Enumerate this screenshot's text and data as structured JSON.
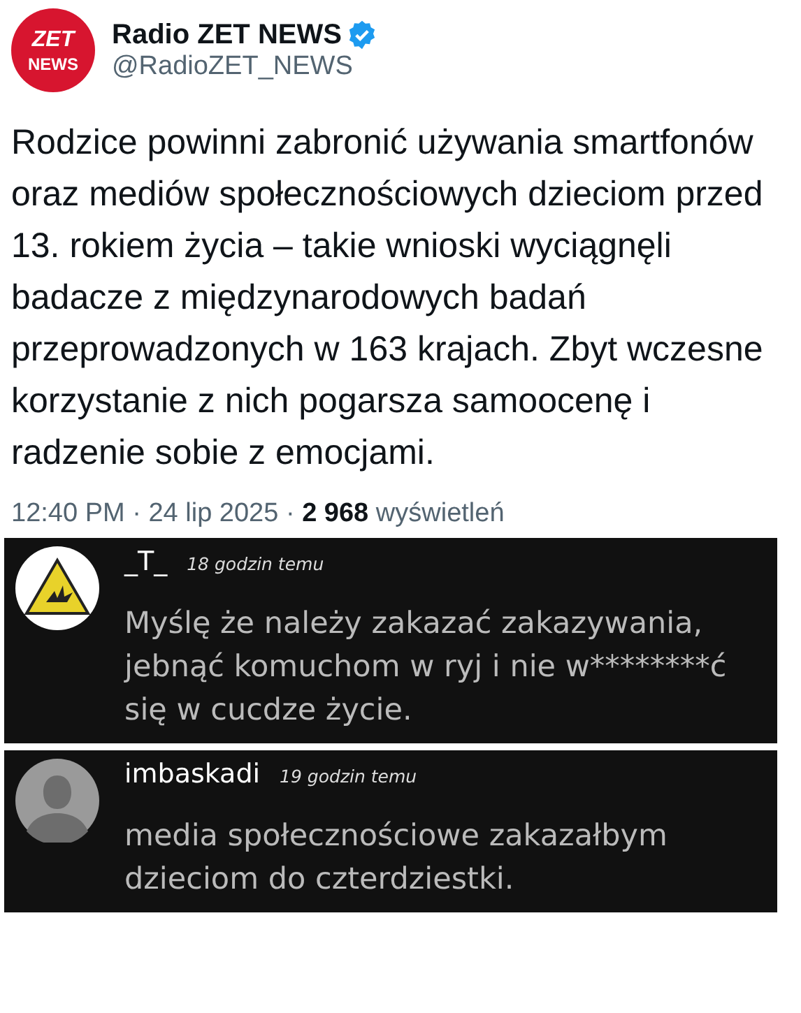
{
  "tweet": {
    "avatar_lines": [
      "ZET",
      "NEWS"
    ],
    "name": "Radio ZET NEWS",
    "verified": true,
    "handle": "@RadioZET_NEWS",
    "text": "Rodzice powinni zabronić używania smartfonów oraz mediów społecznościowych dzieciom przed 13. rokiem życia – takie wnioski wyciągnęli badacze z międzynarodowych badań przeprowadzonych w 163 krajach. Zbyt wczesne korzystanie z nich pogarsza samoocenę i radzenie sobie z emocjami.",
    "meta": "12:40 PM · 24 lip 2025 · **2 968** wyświetleń"
  },
  "comments": [
    {
      "kind": "warning",
      "user": "_T_",
      "time": "18 godzin temu",
      "text": "Myślę że należy zakazać zakazywania, jebnąć komuchom w ryj i nie w********ć się w cucdze życie."
    },
    {
      "kind": "silhouette",
      "user": "imbaskadi",
      "time": "19 godzin temu",
      "text": "media społecznościowe zakazałbym dzieciom do czterdziestki."
    }
  ]
}
